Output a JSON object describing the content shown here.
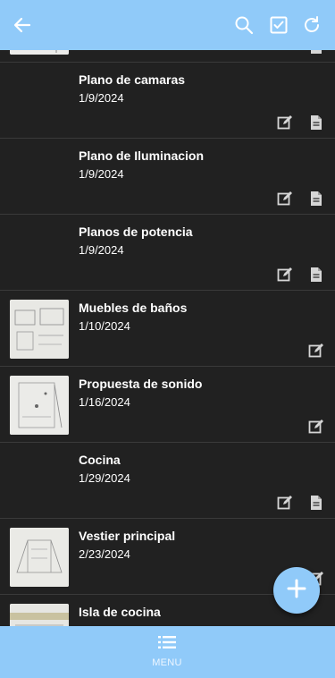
{
  "colors": {
    "bar": "#90caf9",
    "background": "#212121",
    "divider": "#3a3a3a",
    "text": "#ffffff",
    "icon": "#d6d6d6"
  },
  "header": {
    "icons": [
      "back-arrow-icon",
      "search-icon",
      "checkbox-icon",
      "refresh-icon"
    ]
  },
  "items": [
    {
      "title": "Plano de camaras",
      "date": "1/9/2024",
      "has_thumbnail": false,
      "actions": [
        "edit-icon",
        "document-icon"
      ]
    },
    {
      "title": "Plano de Iluminacion",
      "date": "1/9/2024",
      "has_thumbnail": false,
      "actions": [
        "edit-icon",
        "document-icon"
      ]
    },
    {
      "title": "Planos de potencia",
      "date": "1/9/2024",
      "has_thumbnail": false,
      "actions": [
        "edit-icon",
        "document-icon"
      ]
    },
    {
      "title": "Muebles de baños",
      "date": "1/10/2024",
      "has_thumbnail": true,
      "actions": [
        "edit-icon"
      ]
    },
    {
      "title": "Propuesta de sonido",
      "date": "1/16/2024",
      "has_thumbnail": true,
      "actions": [
        "edit-icon"
      ]
    },
    {
      "title": "Cocina",
      "date": "1/29/2024",
      "has_thumbnail": false,
      "actions": [
        "edit-icon",
        "document-icon"
      ]
    },
    {
      "title": "Vestier principal",
      "date": "2/23/2024",
      "has_thumbnail": true,
      "actions": [
        "edit-icon"
      ]
    },
    {
      "title": "Isla de cocina",
      "date": "",
      "has_thumbnail": true,
      "actions": []
    }
  ],
  "fab": {
    "icon": "plus-icon"
  },
  "bottom_nav": {
    "menu_label": "MENU",
    "icon": "list-menu-icon"
  }
}
